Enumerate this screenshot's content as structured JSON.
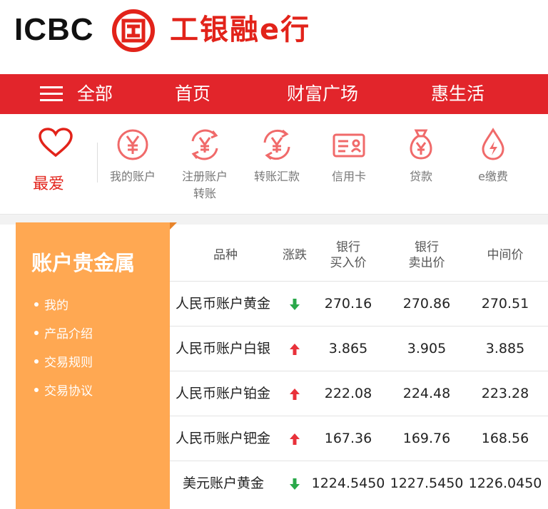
{
  "header": {
    "logo_text": "ICBC",
    "brand_cn": "工银融e行",
    "logo_mark_icon": "icbc-seal-icon"
  },
  "nav": {
    "menu_icon": "hamburger-icon",
    "items": [
      "全部",
      "首页",
      "财富广场",
      "惠生活"
    ]
  },
  "quick": {
    "favorite": {
      "label": "最爱",
      "icon": "heart-icon"
    },
    "items": [
      {
        "label": "我的账户",
        "icon": "yuan-icon"
      },
      {
        "label": "注册账户",
        "label2": "转账",
        "icon": "yuan-transfer-icon"
      },
      {
        "label": "转账汇款",
        "icon": "yuan-remit-icon"
      },
      {
        "label": "信用卡",
        "icon": "credit-card-icon"
      },
      {
        "label": "贷款",
        "icon": "money-bag-icon"
      },
      {
        "label": "e缴费",
        "icon": "drop-bolt-icon"
      }
    ]
  },
  "panel": {
    "title": "账户贵金属",
    "links": [
      "我的",
      "产品介绍",
      "交易规则",
      "交易协议"
    ]
  },
  "table": {
    "headers": {
      "name": "品种",
      "change": "涨跌",
      "buy": [
        "银行",
        "买入价"
      ],
      "sell": [
        "银行",
        "卖出价"
      ],
      "mid": "中间价"
    },
    "rows": [
      {
        "name": "人民币账户黄金",
        "trend": "down",
        "buy": "270.16",
        "sell": "270.86",
        "mid": "270.51"
      },
      {
        "name": "人民币账户白银",
        "trend": "up",
        "buy": "3.865",
        "sell": "3.905",
        "mid": "3.885"
      },
      {
        "name": "人民币账户铂金",
        "trend": "up",
        "buy": "222.08",
        "sell": "224.48",
        "mid": "223.28"
      },
      {
        "name": "人民币账户钯金",
        "trend": "up",
        "buy": "167.36",
        "sell": "169.76",
        "mid": "168.56"
      },
      {
        "name": "美元账户黄金",
        "trend": "down",
        "buy": "1224.5450",
        "sell": "1227.5450",
        "mid": "1226.0450"
      }
    ]
  },
  "colors": {
    "brand_red": "#e2252b",
    "panel_orange": "#ffa852",
    "up_red": "#e8313a",
    "down_green": "#2aa84a",
    "icon_red": "#f06a6a"
  }
}
